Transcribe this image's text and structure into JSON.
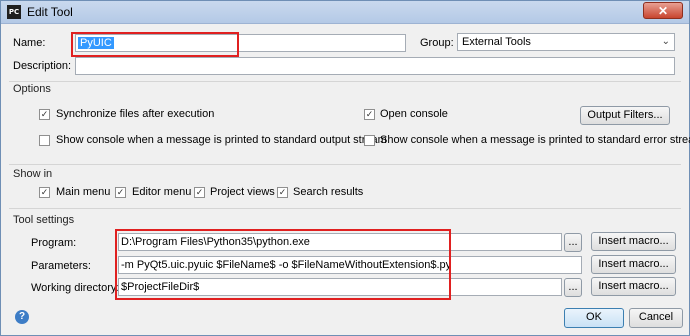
{
  "window": {
    "title": "Edit Tool",
    "app_icon_text": "PC",
    "close_glyph": "✕"
  },
  "name": {
    "label": "Name:",
    "value": "PyUIC"
  },
  "group": {
    "label": "Group:",
    "value": "External Tools"
  },
  "description": {
    "label": "Description:",
    "value": ""
  },
  "options": {
    "header": "Options",
    "sync_files": {
      "label": "Synchronize files after execution",
      "checked": true
    },
    "open_console": {
      "label": "Open console",
      "checked": true
    },
    "output_filters_label": "Output Filters...",
    "stdout_console": {
      "label": "Show console when a message is printed to standard output stream",
      "checked": false
    },
    "stderr_console": {
      "label": "Show console when a message is printed to standard error stream",
      "checked": false
    }
  },
  "show_in": {
    "header": "Show in",
    "items": [
      {
        "label": "Main menu",
        "checked": true
      },
      {
        "label": "Editor menu",
        "checked": true
      },
      {
        "label": "Project views",
        "checked": true
      },
      {
        "label": "Search results",
        "checked": true
      }
    ]
  },
  "tool_settings": {
    "header": "Tool settings",
    "program": {
      "label": "Program:",
      "value": "D:\\Program Files\\Python35\\python.exe"
    },
    "parameters": {
      "label": "Parameters:",
      "value": "-m PyQt5.uic.pyuic  $FileName$ -o $FileNameWithoutExtension$.py"
    },
    "working_directory": {
      "label": "Working directory:",
      "value": "$ProjectFileDir$"
    },
    "browse_label": "...",
    "insert_macro_label": "Insert macro..."
  },
  "footer": {
    "help_glyph": "?",
    "ok_label": "OK",
    "cancel_label": "Cancel"
  },
  "check_glyph": "✓",
  "colors": {
    "annotation_red": "#e02020",
    "selection_blue": "#3399ff"
  }
}
